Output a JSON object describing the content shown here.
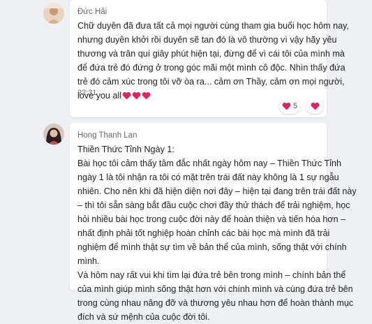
{
  "messages": [
    {
      "author": "Đức Hải",
      "lines": [
        "Chữ duyên đã đưa tất cả mọi người cùng tham gia buổi học hôm nay,",
        "nhưng duyên khởi rồi duyên sẽ tan đó là vô thường vì vậy hãy yêu",
        "thương và trân quí giây phút hiện tại, đừng để vì cái tôi của mình mà",
        "để đứa trẻ đó đứng ở trong góc mãi một mình cô độc. Nhìn thấy đứa",
        "trẻ đó cảm xúc trong tôi vỡ òa ra... cảm ơn Thầy, cảm ơn mọi người,",
        "love you all"
      ],
      "time": "22:31",
      "reaction_count": "5",
      "colors": {
        "heart": "#e0245e"
      }
    },
    {
      "author": "Hong Thanh Lan",
      "lines": [
        "Thiền Thức Tỉnh Ngày 1:",
        "Bài học tôi cảm thấy tâm đắc nhất ngày hôm nay – Thiền Thức Tỉnh",
        "ngày 1 là tôi nhận ra tôi có mặt trên trái đất này không là 1 sự ngẫu",
        "nhiên. Cho nên khi đã hiện diện nơi đây – hiện tại đang trên trái đất này",
        "– thì tôi sẵn sàng bắt đầu cuộc chơi đầy thử thách để trải nghiệm, học",
        "hỏi nhiều bài học trong cuộc đời này để hoàn thiện và tiến hóa hơn –",
        "nhất định phải tốt nghiệp hoàn chỉnh các bài học mà mình đã trải",
        "nghiệm để mình thật sự tìm về bản thể của mình, sống thật với chính",
        "mình.",
        "Và hôm nay rất vui khi tìm lại đứa trẻ bên trong mình – chính bản thể",
        "của mình giúp mình sống thật hơn với chính mình và cùng đứa trẻ bên",
        "trong cùng nhau nâng đỡ và thương yêu nhau hơn để hoàn thành mục",
        "đích và sứ mệnh của cuộc đời tôi."
      ]
    }
  ]
}
